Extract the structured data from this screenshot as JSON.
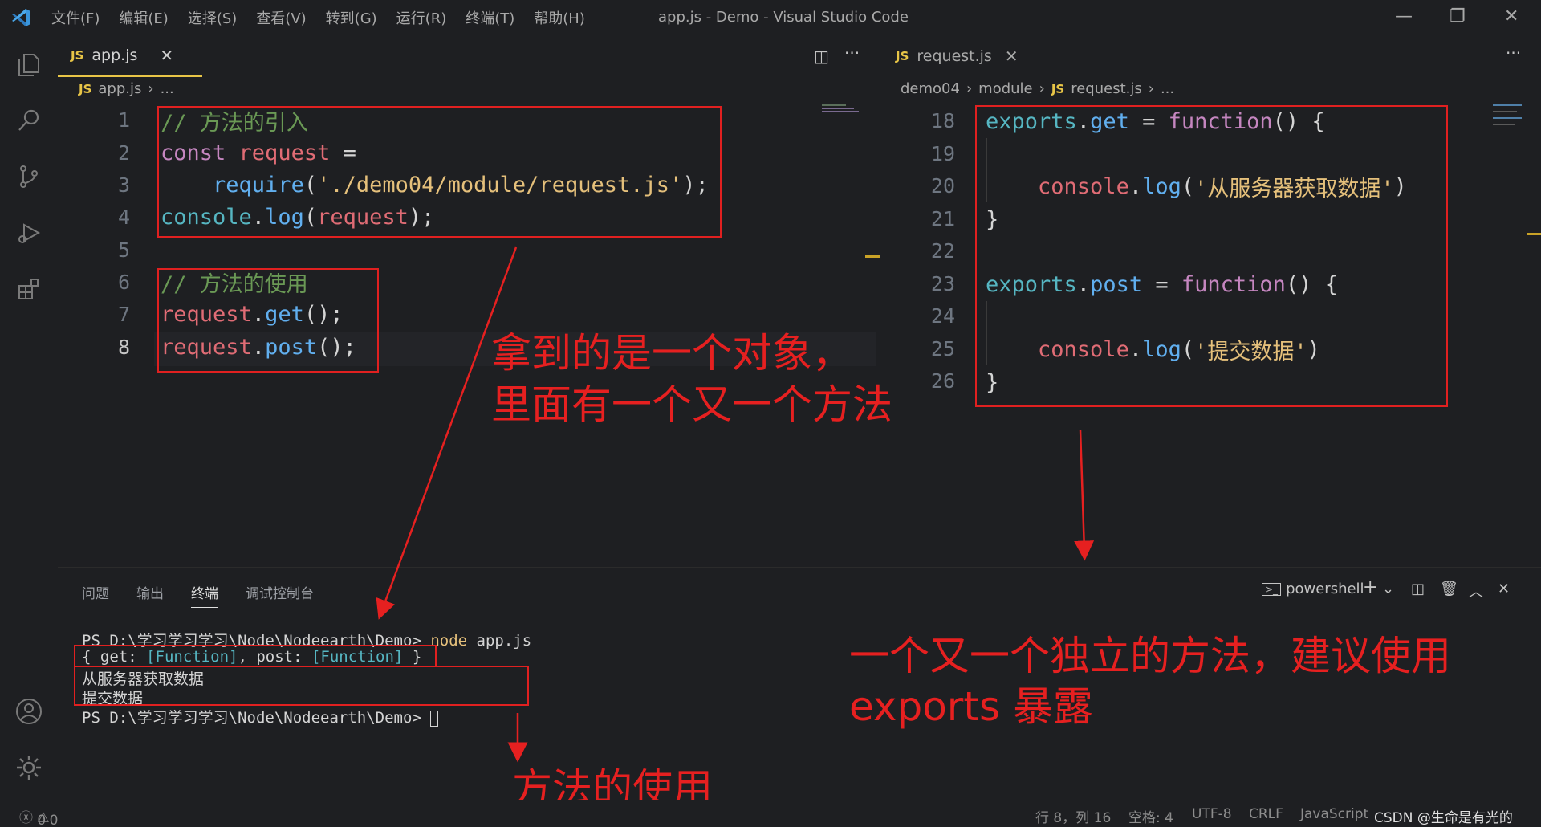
{
  "window": {
    "title": "app.js - Demo - Visual Studio Code",
    "menu": [
      "文件(F)",
      "编辑(E)",
      "选择(S)",
      "查看(V)",
      "转到(G)",
      "运行(R)",
      "终端(T)",
      "帮助(H)"
    ]
  },
  "left_editor": {
    "tab_badge": "JS",
    "tab_label": "app.js",
    "breadcrumb_file": "app.js",
    "breadcrumb_more": "...",
    "line_numbers": [
      "1",
      "2",
      "3",
      "4",
      "5",
      "6",
      "7",
      "8"
    ],
    "code": {
      "l1": "// 方法的引入",
      "l2_kw": "const",
      "l2_var": "request",
      "l2_op": " =",
      "l3_fn": "require",
      "l3_open": "(",
      "l3_str": "'./demo04/module/request.js'",
      "l3_close": ");",
      "l4_obj": "console",
      "l4_fn": "log",
      "l4_arg": "request",
      "l6": "// 方法的使用",
      "l7_var": "request",
      "l7_fn": "get",
      "l7_tail": "();",
      "l8_var": "request",
      "l8_fn": "post",
      "l8_tail": "();"
    }
  },
  "right_editor": {
    "tab_badge": "JS",
    "tab_label": "request.js",
    "breadcrumb": [
      "demo04",
      "module",
      "request.js",
      "..."
    ],
    "line_numbers": [
      "18",
      "19",
      "20",
      "21",
      "22",
      "23",
      "24",
      "25",
      "26"
    ],
    "code": {
      "l18_obj": "exports",
      "l18_prop": "get",
      "l18_kw": "function",
      "l20_obj": "console",
      "l20_fn": "log",
      "l20_str": "'从服务器获取数据'",
      "l23_obj": "exports",
      "l23_prop": "post",
      "l23_kw": "function",
      "l25_obj": "console",
      "l25_fn": "log",
      "l25_str": "'提交数据'"
    }
  },
  "panel": {
    "tabs": [
      "问题",
      "输出",
      "终端",
      "调试控制台"
    ],
    "active_tab": "终端",
    "shell": "powershell",
    "terminal": {
      "line1_prompt": "PS D:\\学习学习学习\\Node\\Nodeearth\\Demo>",
      "line1_cmd": "node",
      "line1_arg": "app.js",
      "line2_a": "{ get: ",
      "line2_b": "[Function]",
      "line2_c": ", post: ",
      "line2_d": "[Function]",
      "line2_e": " }",
      "line3": "从服务器获取数据",
      "line4": "提交数据",
      "line5_prompt": "PS D:\\学习学习学习\\Node\\Nodeearth\\Demo>"
    }
  },
  "annotations": {
    "a1_line1": "拿到的是一个对象，",
    "a1_line2": "里面有一个又一个方法",
    "a2_line1": "一个又一个独立的方法，建议使用",
    "a2_line2": "exports 暴露",
    "a3": "方法的使用"
  },
  "status": {
    "errors": "0",
    "warnings": "0",
    "position": "行 8，列 16",
    "spaces": "空格: 4",
    "encoding": "UTF-8",
    "eol": "CRLF",
    "language": "JavaScript",
    "watermark": "CSDN @生命是有光的"
  },
  "colors": {
    "annotation_red": "#e62020",
    "js_badge": "#e8c547",
    "background": "#1e1f22"
  }
}
